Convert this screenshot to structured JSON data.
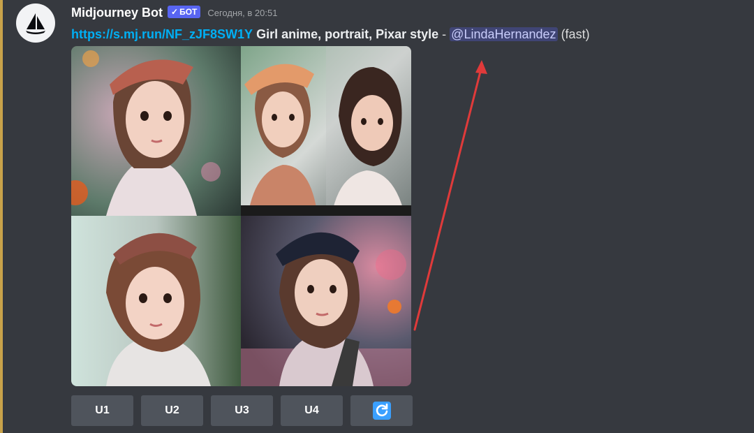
{
  "message": {
    "author": "Midjourney Bot",
    "bot_badge": "БОТ",
    "timestamp": "Сегодня, в 20:51",
    "link": "https://s.mj.run/NF_zJF8SW1Y",
    "prompt": "Girl anime, portrait, Pixar style",
    "separator": " - ",
    "mention": "@LindaHernandez",
    "speed": "(fast)"
  },
  "images": {
    "count": 4,
    "description_names": [
      "image-1",
      "image-2",
      "image-3",
      "image-4"
    ]
  },
  "buttons": [
    {
      "label": "U1"
    },
    {
      "label": "U2"
    },
    {
      "label": "U3"
    },
    {
      "label": "U4"
    }
  ],
  "colors": {
    "background": "#36393f",
    "link": "#00aff4",
    "badge": "#5865f2",
    "button": "#4f545c",
    "refresh_icon": "#3ba0ff",
    "arrow": "#e03a3a",
    "accent_bar": "#c8a24a"
  },
  "icons": {
    "avatar": "sailboat-icon",
    "badge_check": "checkmark-icon",
    "reroll": "refresh-icon"
  }
}
